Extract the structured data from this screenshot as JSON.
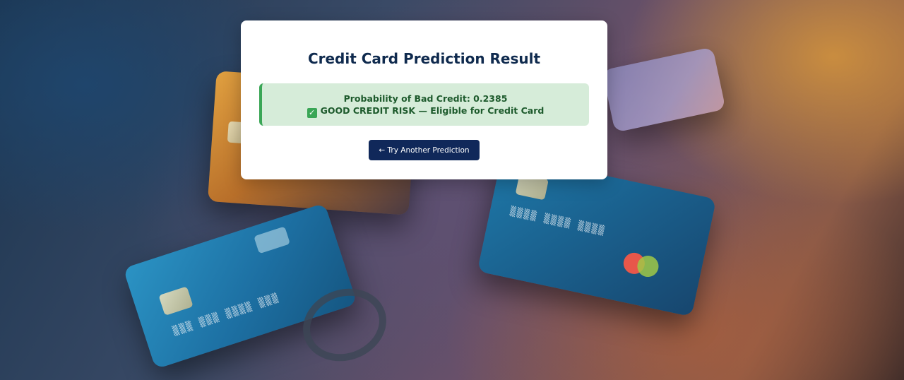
{
  "result": {
    "title": "Credit Card Prediction Result",
    "probability_text": "Probability of Bad Credit: 0.2385",
    "verdict_text": "GOOD CREDIT RISK — Eligible for Credit Card",
    "status_icon": "check-icon",
    "status_color": "#3aa656"
  },
  "actions": {
    "retry_label": "← Try Another Prediction"
  },
  "colors": {
    "title": "#0f2a4e",
    "button_bg": "#10285a",
    "success_bg": "#d6ecd9"
  }
}
